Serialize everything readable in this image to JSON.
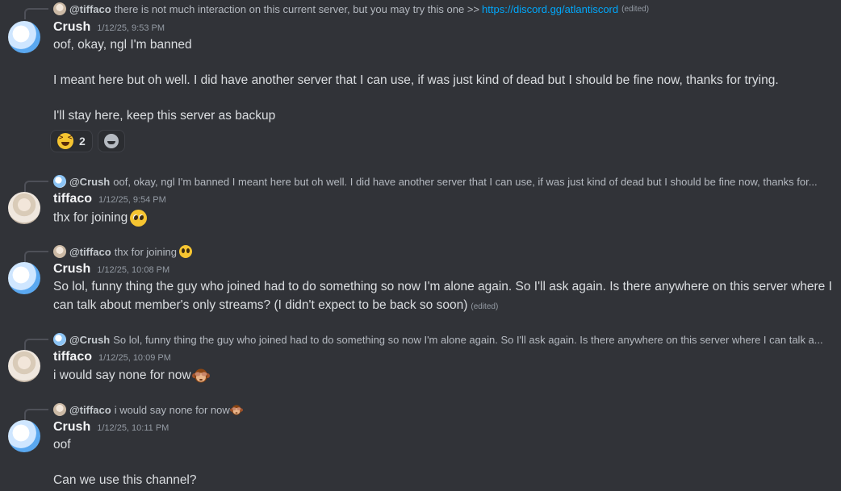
{
  "messages": [
    {
      "reply": {
        "author": "@tiffaco",
        "text": "there is not much interaction on this current server,  but you may try this one >>",
        "link": "https://discord.gg/atlantiscord",
        "edited": "(edited)"
      },
      "author": "Crush",
      "timestamp": "1/12/25, 9:53 PM",
      "lines": [
        "oof, okay, ngl I'm banned",
        "I meant here but oh well. I did have another server that I can use, if was just kind of dead but I should be fine now, thanks for trying.",
        "I'll stay here, keep this server as backup"
      ],
      "reactions": [
        {
          "emoji": "laughing-squint-emoji",
          "count": "2"
        },
        {
          "emoji": "add-reaction-icon"
        }
      ]
    },
    {
      "reply": {
        "author": "@Crush",
        "text": "oof, okay, ngl I'm banned  I meant here but oh well. I did have another server that I can use, if was just kind of dead but I should be fine now, thanks for..."
      },
      "author": "tiffaco",
      "timestamp": "1/12/25, 9:54 PM",
      "lines": [
        "thx for joining"
      ]
    },
    {
      "reply": {
        "author": "@tiffaco",
        "text": "thx for joining"
      },
      "author": "Crush",
      "timestamp": "1/12/25, 10:08 PM",
      "lines": [
        "So lol, funny thing the guy who joined had to do something so now I'm alone again. So I'll ask again. Is there  anywhere on this server where I",
        "can talk about member's only streams? (I didn't expect to be back so soon)"
      ],
      "edited": "(edited)"
    },
    {
      "reply": {
        "author": "@Crush",
        "text": "So lol, funny thing the guy who joined had to do something so now I'm alone again. So I'll ask again. Is there  anywhere on this server where I can talk a..."
      },
      "author": "tiffaco",
      "timestamp": "1/12/25, 10:09 PM",
      "lines": [
        "i would say none for now"
      ]
    },
    {
      "reply": {
        "author": "@tiffaco",
        "text": "i would say none for now"
      },
      "author": "Crush",
      "timestamp": "1/12/25, 10:11 PM",
      "lines": [
        "oof",
        "Can we use this channel?"
      ]
    }
  ],
  "colors": {
    "background": "#313338",
    "link": "#00a8fc",
    "author": "#f2f3f5",
    "text": "#dbdee1",
    "muted": "#949ba4"
  }
}
